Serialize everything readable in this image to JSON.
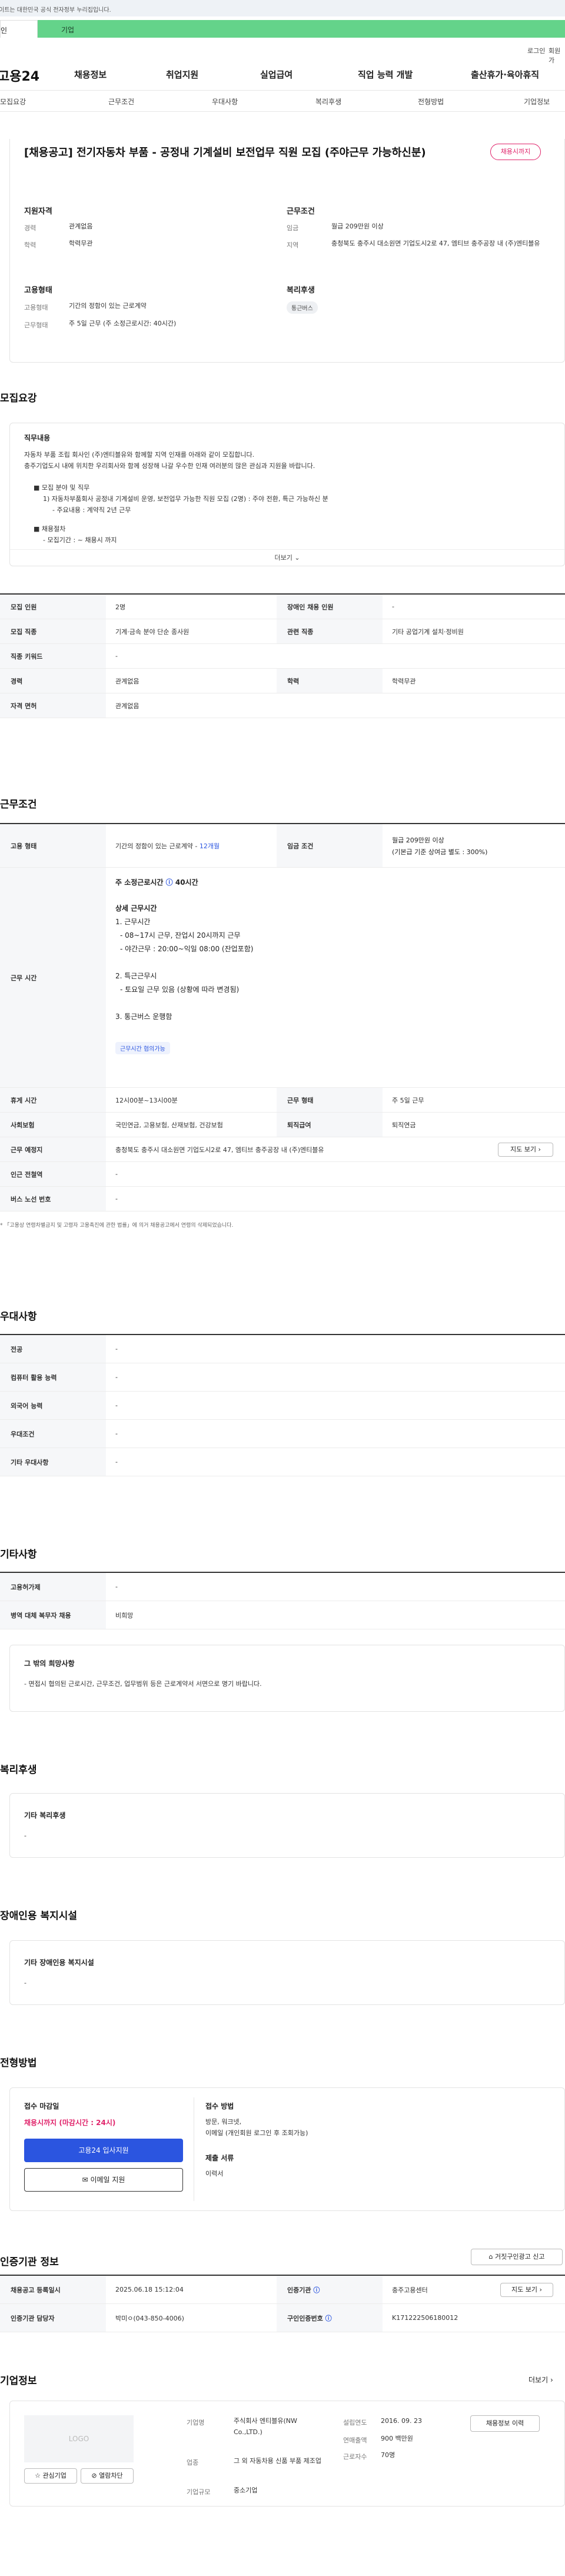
{
  "gov_banner": "이트는 대한민국 공식 전자정부 누리집입니다.",
  "tabs": {
    "a": "인",
    "b": "기업"
  },
  "util": {
    "login": "로그인",
    "join": "회원가"
  },
  "gnb": {
    "logo": "고용24",
    "menu": [
      "채용정보",
      "취업지원",
      "실업급여",
      "직업 능력 개발",
      "출산휴가·육아휴직"
    ]
  },
  "subnav": [
    "모집요강",
    "근무조건",
    "우대사항",
    "복리후생",
    "전형방법",
    "기업정보"
  ],
  "job": {
    "title": "[채용공고] 전기자동차 부품 - 공정내 기계설비 보전업무 직원 모집 (주야근무 가능하신분)",
    "badge": "채용시까지",
    "summary": {
      "req_title": "지원자격",
      "career_k": "경력",
      "career_v": "관계없음",
      "edu_k": "학력",
      "edu_v": "학력무관",
      "cond_title": "근무조건",
      "wage_k": "임금",
      "wage_v": "월급 209만원 이상",
      "loc_k": "지역",
      "loc_v": "충청북도 충주시 대소원면 기업도시2로 47, 엠티브 충주공장 내 (주)엔티블유",
      "emp_title": "고용형태",
      "emptype_k": "고용형태",
      "emptype_v": "기간의 정함이 있는 근로계약",
      "hours_k": "근무형태",
      "hours_v": "주 5일 근무 (주 소정근로시간: 40시간)",
      "ben_title": "복리후생",
      "ben_chip": "통근버스"
    }
  },
  "recruit": {
    "title": "모집요강",
    "box_title": "직무내용",
    "lines": [
      "자동차 부품 조립 회사인 (주)엔티블유와 함께할 지역 인재를 아래와 같이 모집합니다.",
      "충주기업도시 내에 위치한 우리회사와 함께 성장해 나갈 우수한 인재 여러분의 많은 관심과 지원을 바랍니다.",
      "■ 모집 분야 및 직무",
      "1) 자동차부품회사 공정내 기계설비 운영, 보전업무 가능한 직원 모집 (2명) : 주야 전환, 특근 가능하신 분",
      "- 주요내용 : 계약직 2년 근무",
      "■ 채용절차",
      "- 모집기간 : ~ 채용시 까지"
    ],
    "more": "더보기",
    "rows": [
      [
        "모집 인원",
        "2명",
        "장애인 채용 인원",
        "-"
      ],
      [
        "모집 직종",
        "기계·금속 분야 단순 종사원",
        "관련 직종",
        "기타 공업기계 설치·정비원"
      ],
      [
        "직종 키워드",
        "-",
        "",
        ""
      ],
      [
        "경력",
        "관계없음",
        "학력",
        "학력무관"
      ],
      [
        "자격 면허",
        "관계없음",
        "",
        ""
      ]
    ]
  },
  "work": {
    "title": "근무조건",
    "emp_k": "고용 형태",
    "emp_v": "기간의 정함이 있는 근로계약 -",
    "emp_v2": "12개월",
    "wage_k": "임금 조건",
    "wage_v1": "월급 209만원 이상",
    "wage_v2": "(기본급 기준 상여금 별도 : 300%)",
    "hours_k": "근무 시간",
    "hours_head": "주 소정근로시간",
    "hours_head2": "40시간",
    "hours_lines": [
      "상세 근무시간",
      "1. 근무시간",
      "- 08~17시 근무, 잔업시 20시까지 근무",
      "- 야간근무 : 20:00~익일 08:00 (잔업포함)",
      "",
      "2. 특근근무시",
      "- 토요일 근무 있음 (상황에 따라 변경됨)",
      "",
      "3. 통근버스 운행함"
    ],
    "hours_chip": "근무시간 협의가능",
    "rows": [
      [
        "휴게 시간",
        "12시00분~13시00분",
        "근무 형태",
        "주 5일 근무"
      ],
      [
        "사회보험",
        "국민연금, 고용보험, 산재보험, 건강보험",
        "퇴직급여",
        "퇴직연금"
      ],
      [
        "근무 예정지",
        "충청북도 충주시 대소원면 기업도시2로 47, 엠티브 충주공장 내 (주)엔티블유",
        "",
        ""
      ],
      [
        "인근 전철역",
        "-",
        "",
        ""
      ],
      [
        "버스 노선 번호",
        "-",
        "",
        ""
      ]
    ],
    "map_btn": "지도 보기",
    "note": "* 「고용상 연령차별금지 및 고령자 고용촉진에 관한 법률」에 의거 채용공고에서 연령의 삭제되었습니다."
  },
  "pref": {
    "title": "우대사항",
    "rows": [
      [
        "전공",
        "-"
      ],
      [
        "컴퓨터 활용 능력",
        "-"
      ],
      [
        "외국어 능력",
        "-"
      ],
      [
        "우대조건",
        "-"
      ],
      [
        "기타 우대사항",
        "-"
      ]
    ]
  },
  "etc": {
    "title": "기타사항",
    "rows": [
      [
        "고용허가제",
        "-"
      ],
      [
        "병역 대체 복무자 채용",
        "비희망"
      ]
    ],
    "box_title": "그 밖의 희망사항",
    "box_text": "- 면접시 협의된 근로시간, 근무조건, 업무범위 등은 근로계약서 서면으로 명기 바랍니다."
  },
  "benefit": {
    "title": "복리후생",
    "box_title": "기타 복리후생",
    "box_text": "-"
  },
  "disab": {
    "title": "장애인용 복지시설",
    "box_title": "기타 장애인용 복지시설",
    "box_text": "-"
  },
  "screen": {
    "title": "전형방법",
    "deadline_k": "접수 마감일",
    "deadline_v": "채용시까지 (마감시간 : 24시)",
    "apply_btn": "고용24 입사지원",
    "email_btn": "이메일 지원",
    "method_k": "접수 방법",
    "method_v1": "방문, 워크넷,",
    "method_v2": "이메일 (개인회원 로그인 후 조회가능)",
    "docs_k": "제출 서류",
    "docs_v": "이력서"
  },
  "cert": {
    "title": "인증기관 정보",
    "report_btn": "거짓구인광고 신고",
    "rows": [
      [
        "채용공고 등록일시",
        "2025.06.18 15:12:04",
        "인증기관",
        "충주고용센터"
      ],
      [
        "인증기관 담당자",
        "박미ㅇ(043-850-4006)",
        "구인인증번호",
        "K171222506180012"
      ]
    ],
    "map_btn": "지도 보기"
  },
  "company": {
    "title": "기업정보",
    "more": "더보기",
    "logo": "LOGO",
    "fav_btn": "관심기업",
    "block_btn": "열람차단",
    "name_k": "기업명",
    "name_v": "주식회사 엔티블유(NW Co.,LTD.)",
    "ind_k": "업종",
    "ind_v": "그 외 자동차용 신품 부품 제조업",
    "size_k": "기업규모",
    "size_v": "중소기업",
    "est_k": "설립연도",
    "est_v": "2016. 09. 23",
    "rev_k": "연매출액",
    "rev_v": "900 백만원",
    "emp_k": "근로자수",
    "emp_v": "70명",
    "jobs_btn": "채용정보 이력"
  },
  "colors": {
    "accent": "#2b55e0",
    "badge": "#e0246b",
    "green": "#64d38a"
  }
}
